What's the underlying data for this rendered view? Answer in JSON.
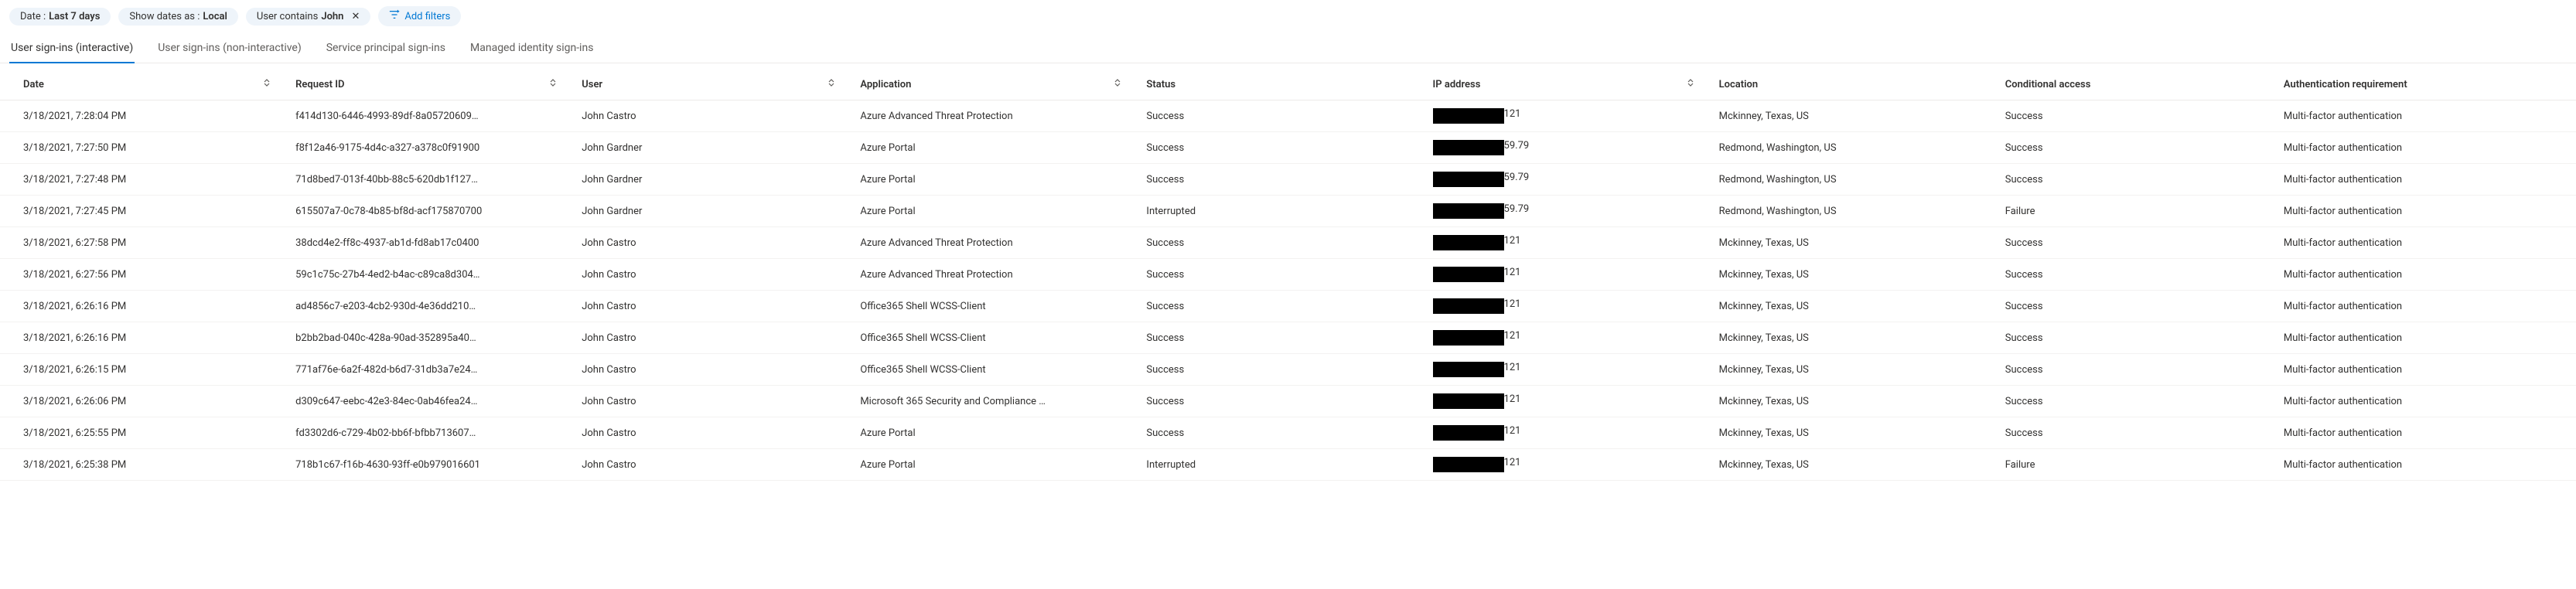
{
  "filters": {
    "date_label": "Date :",
    "date_value": "Last 7 days",
    "show_dates_label": "Show dates as :",
    "show_dates_value": "Local",
    "user_label": "User contains",
    "user_value": "John",
    "add_filters": "Add filters"
  },
  "tabs": [
    {
      "label": "User sign-ins (interactive)",
      "active": true
    },
    {
      "label": "User sign-ins (non-interactive)",
      "active": false
    },
    {
      "label": "Service principal sign-ins",
      "active": false
    },
    {
      "label": "Managed identity sign-ins",
      "active": false
    }
  ],
  "columns": {
    "date": "Date",
    "request_id": "Request ID",
    "user": "User",
    "application": "Application",
    "status": "Status",
    "ip": "IP address",
    "location": "Location",
    "conditional_access": "Conditional access",
    "auth_req": "Authentication requirement"
  },
  "rows": [
    {
      "date": "3/18/2021, 7:28:04 PM",
      "request_id": "f414d130-6446-4993-89df-8a05720609…",
      "user": "John Castro",
      "application": "Azure Advanced Threat Protection",
      "status": "Success",
      "ip_suffix": "121",
      "location": "Mckinney, Texas, US",
      "cond": "Success",
      "auth": "Multi-factor authentication"
    },
    {
      "date": "3/18/2021, 7:27:50 PM",
      "request_id": "f8f12a46-9175-4d4c-a327-a378c0f91900",
      "user": "John Gardner",
      "application": "Azure Portal",
      "status": "Success",
      "ip_suffix": "59.79",
      "location": "Redmond, Washington, US",
      "cond": "Success",
      "auth": "Multi-factor authentication"
    },
    {
      "date": "3/18/2021, 7:27:48 PM",
      "request_id": "71d8bed7-013f-40bb-88c5-620db1f127…",
      "user": "John Gardner",
      "application": "Azure Portal",
      "status": "Success",
      "ip_suffix": "59.79",
      "location": "Redmond, Washington, US",
      "cond": "Success",
      "auth": "Multi-factor authentication"
    },
    {
      "date": "3/18/2021, 7:27:45 PM",
      "request_id": "615507a7-0c78-4b85-bf8d-acf175870700",
      "user": "John Gardner",
      "application": "Azure Portal",
      "status": "Interrupted",
      "ip_suffix": "59.79",
      "location": "Redmond, Washington, US",
      "cond": "Failure",
      "auth": "Multi-factor authentication"
    },
    {
      "date": "3/18/2021, 6:27:58 PM",
      "request_id": "38dcd4e2-ff8c-4937-ab1d-fd8ab17c0400",
      "user": "John Castro",
      "application": "Azure Advanced Threat Protection",
      "status": "Success",
      "ip_suffix": "121",
      "location": "Mckinney, Texas, US",
      "cond": "Success",
      "auth": "Multi-factor authentication"
    },
    {
      "date": "3/18/2021, 6:27:56 PM",
      "request_id": "59c1c75c-27b4-4ed2-b4ac-c89ca8d304…",
      "user": "John Castro",
      "application": "Azure Advanced Threat Protection",
      "status": "Success",
      "ip_suffix": "121",
      "location": "Mckinney, Texas, US",
      "cond": "Success",
      "auth": "Multi-factor authentication"
    },
    {
      "date": "3/18/2021, 6:26:16 PM",
      "request_id": "ad4856c7-e203-4cb2-930d-4e36dd210…",
      "user": "John Castro",
      "application": "Office365 Shell WCSS-Client",
      "status": "Success",
      "ip_suffix": "121",
      "location": "Mckinney, Texas, US",
      "cond": "Success",
      "auth": "Multi-factor authentication"
    },
    {
      "date": "3/18/2021, 6:26:16 PM",
      "request_id": "b2bb2bad-040c-428a-90ad-352895a40…",
      "user": "John Castro",
      "application": "Office365 Shell WCSS-Client",
      "status": "Success",
      "ip_suffix": "121",
      "location": "Mckinney, Texas, US",
      "cond": "Success",
      "auth": "Multi-factor authentication"
    },
    {
      "date": "3/18/2021, 6:26:15 PM",
      "request_id": "771af76e-6a2f-482d-b6d7-31db3a7e24…",
      "user": "John Castro",
      "application": "Office365 Shell WCSS-Client",
      "status": "Success",
      "ip_suffix": "121",
      "location": "Mckinney, Texas, US",
      "cond": "Success",
      "auth": "Multi-factor authentication"
    },
    {
      "date": "3/18/2021, 6:26:06 PM",
      "request_id": "d309c647-eebc-42e3-84ec-0ab46fea24…",
      "user": "John Castro",
      "application": "Microsoft 365 Security and Compliance …",
      "status": "Success",
      "ip_suffix": "121",
      "location": "Mckinney, Texas, US",
      "cond": "Success",
      "auth": "Multi-factor authentication"
    },
    {
      "date": "3/18/2021, 6:25:55 PM",
      "request_id": "fd3302d6-c729-4b02-bb6f-bfbb713607…",
      "user": "John Castro",
      "application": "Azure Portal",
      "status": "Success",
      "ip_suffix": "121",
      "location": "Mckinney, Texas, US",
      "cond": "Success",
      "auth": "Multi-factor authentication"
    },
    {
      "date": "3/18/2021, 6:25:38 PM",
      "request_id": "718b1c67-f16b-4630-93ff-e0b979016601",
      "user": "John Castro",
      "application": "Azure Portal",
      "status": "Interrupted",
      "ip_suffix": "121",
      "location": "Mckinney, Texas, US",
      "cond": "Failure",
      "auth": "Multi-factor authentication"
    }
  ]
}
